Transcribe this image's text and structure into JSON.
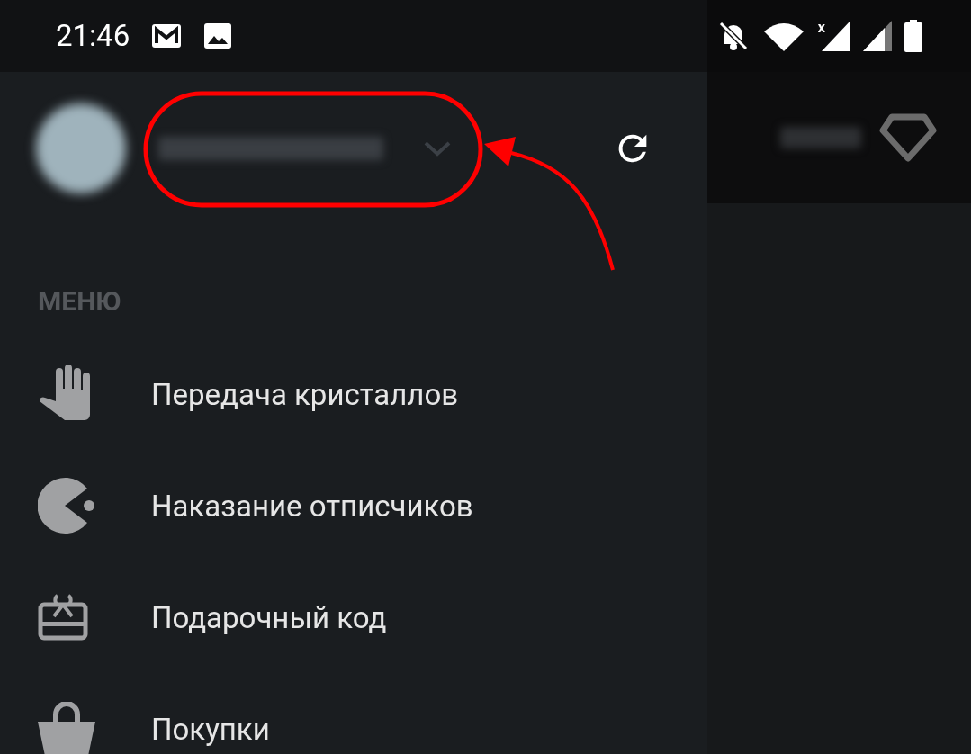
{
  "status_bar": {
    "time": "21:46",
    "signal_label": "x"
  },
  "drawer": {
    "section_title": "МЕНЮ",
    "items": [
      {
        "label": "Передача кристаллов"
      },
      {
        "label": "Наказание отписчиков"
      },
      {
        "label": "Подарочный код"
      },
      {
        "label": "Покупки"
      }
    ]
  }
}
